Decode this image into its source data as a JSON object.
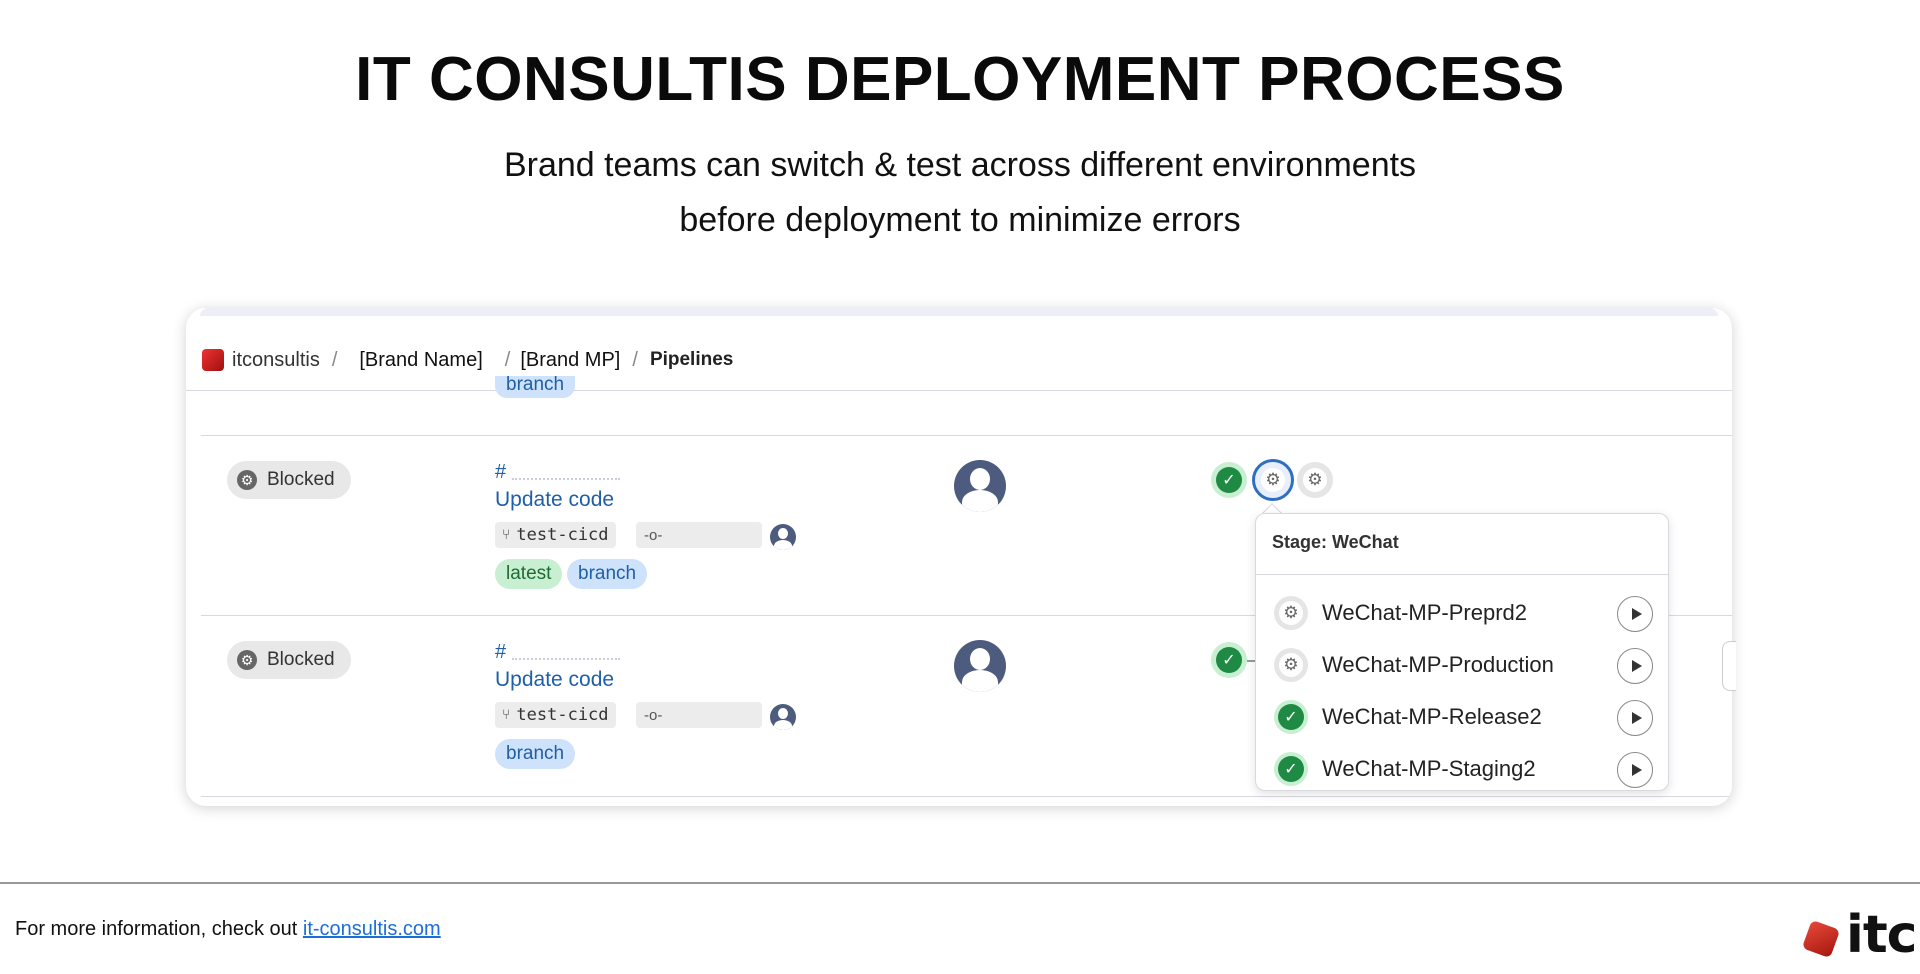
{
  "header": {
    "title": "IT CONSULTIS DEPLOYMENT PROCESS",
    "subtitle_line1": "Brand teams can switch & test across different environments",
    "subtitle_line2": "before deployment to minimize errors"
  },
  "breadcrumb": {
    "org": "itconsultis",
    "group": "[Brand Name]",
    "project": "[Brand MP]",
    "page": "Pipelines",
    "separator": "/"
  },
  "top_partial_row": {
    "tag": "branch"
  },
  "pipelines": [
    {
      "status": "Blocked",
      "hash_prefix": "#",
      "title": "Update code",
      "ref": "test-cicd",
      "tags": [
        "latest",
        "branch"
      ]
    },
    {
      "status": "Blocked",
      "hash_prefix": "#",
      "title": "Update code",
      "ref": "test-cicd",
      "tags": [
        "branch"
      ]
    }
  ],
  "stage_popover": {
    "heading": "Stage: WeChat",
    "jobs": [
      {
        "name": "WeChat-MP-Preprd2",
        "status": "manual",
        "icon": "gear-icon"
      },
      {
        "name": "WeChat-MP-Production",
        "status": "manual",
        "icon": "gear-icon"
      },
      {
        "name": "WeChat-MP-Release2",
        "status": "passed",
        "icon": "check-icon"
      },
      {
        "name": "WeChat-MP-Staging2",
        "status": "passed",
        "icon": "check-icon"
      }
    ]
  },
  "colors": {
    "link_blue": "#1f5fa8",
    "success_green": "#1e8a43",
    "selected_blue": "#2f6fc1",
    "brand_red": "#c0221a"
  },
  "footer": {
    "prefix": "For more information, check out ",
    "link_text": "it-consultis.com",
    "brand": "itc"
  }
}
